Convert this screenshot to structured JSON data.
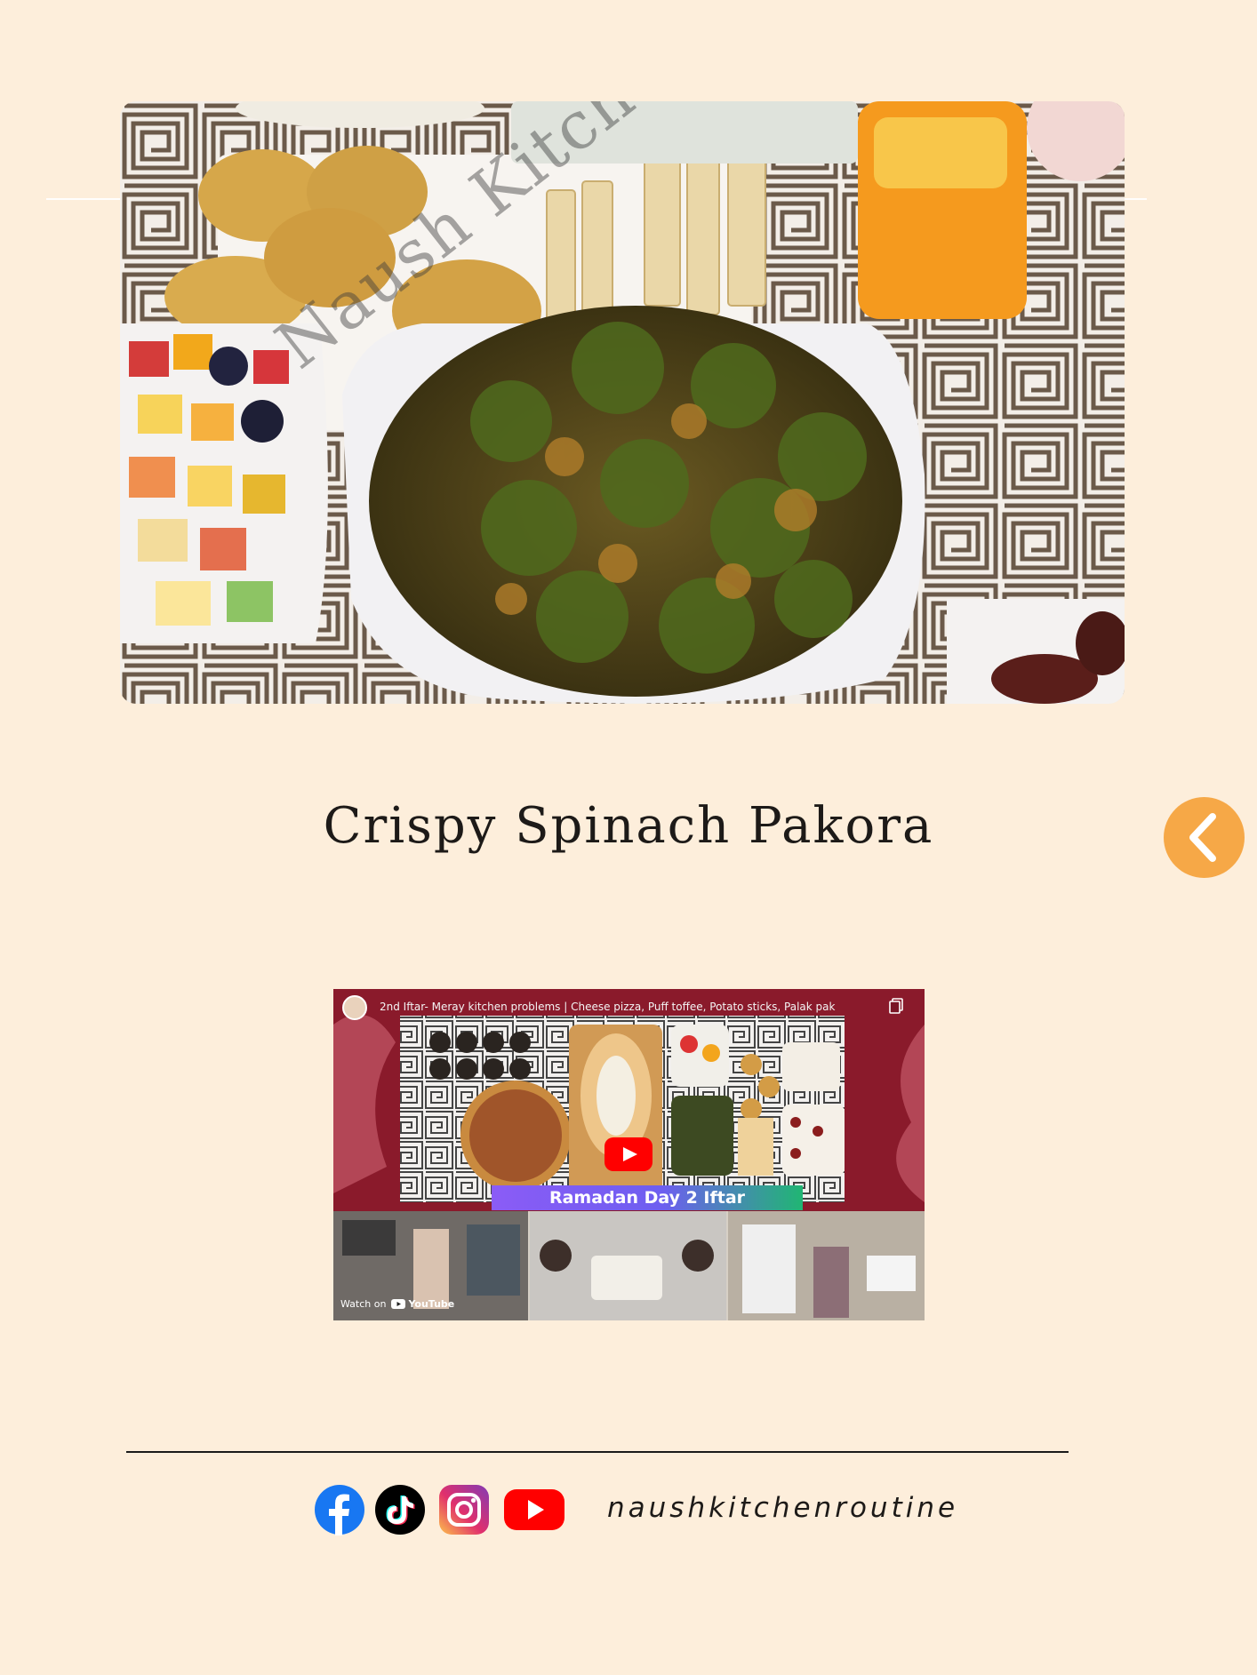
{
  "hero": {
    "watermark": "Naush Kitchen Routine™"
  },
  "title": "Crispy Spinach Pakora",
  "back_button": {
    "icon": "chevron-left-icon",
    "color": "#f6a847"
  },
  "video": {
    "title": "2nd Iftar- Meray kitchen problems | Cheese pizza, Puff toffee, Potato sticks, Palak pak",
    "badge": "Ramadan Day 2 Iftar",
    "watch_on": "Watch on",
    "platform": "YouTube"
  },
  "footer": {
    "handle": "naushkitchenroutine",
    "socials": [
      {
        "name": "facebook-icon",
        "color": "#1877f2"
      },
      {
        "name": "tiktok-icon",
        "color": "#000000"
      },
      {
        "name": "instagram-icon",
        "color": "#d62976"
      },
      {
        "name": "youtube-icon",
        "color": "#ff0000"
      }
    ]
  },
  "colors": {
    "background": "#fdeedb",
    "accent": "#f6a847"
  }
}
